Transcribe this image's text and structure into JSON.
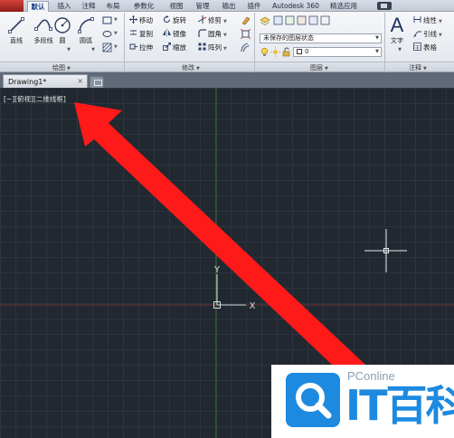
{
  "tabs": [
    {
      "label": "默认",
      "active": true
    },
    {
      "label": "插入"
    },
    {
      "label": "注释"
    },
    {
      "label": "布局"
    },
    {
      "label": "参数化"
    },
    {
      "label": "视图"
    },
    {
      "label": "管理"
    },
    {
      "label": "输出"
    },
    {
      "label": "插件"
    },
    {
      "label": "Autodesk 360"
    },
    {
      "label": "精选应用"
    }
  ],
  "draw_panel": {
    "title": "绘图",
    "tools": {
      "line": "直线",
      "polyline": "多段线",
      "circle": "圆",
      "arc": "圆弧"
    }
  },
  "modify_panel": {
    "title": "修改",
    "tools": {
      "move": "移动",
      "rotate": "旋转",
      "trim": "修剪",
      "copy": "复制",
      "mirror": "镜像",
      "fillet": "圆角",
      "stretch": "拉伸",
      "scale": "缩放",
      "array": "阵列"
    }
  },
  "layers_panel": {
    "title": "图层",
    "layer_state": "未保存的图层状态",
    "current_layer": "0"
  },
  "annotation_panel": {
    "title": "注释",
    "text": "文字",
    "linear": "线性",
    "leader": "引线",
    "table": "表格"
  },
  "document_tab": {
    "title": "Drawing1*",
    "close": "×"
  },
  "viewport_label": "[−][俯视][二维线框]",
  "ucs": {
    "y": "Y",
    "x": "X"
  },
  "watermark": {
    "small": "PConline",
    "big": "IT百科"
  },
  "colors": {
    "accent": "#1d8ae0",
    "arrow": "#ff1a1a",
    "canvas": "#212830"
  }
}
